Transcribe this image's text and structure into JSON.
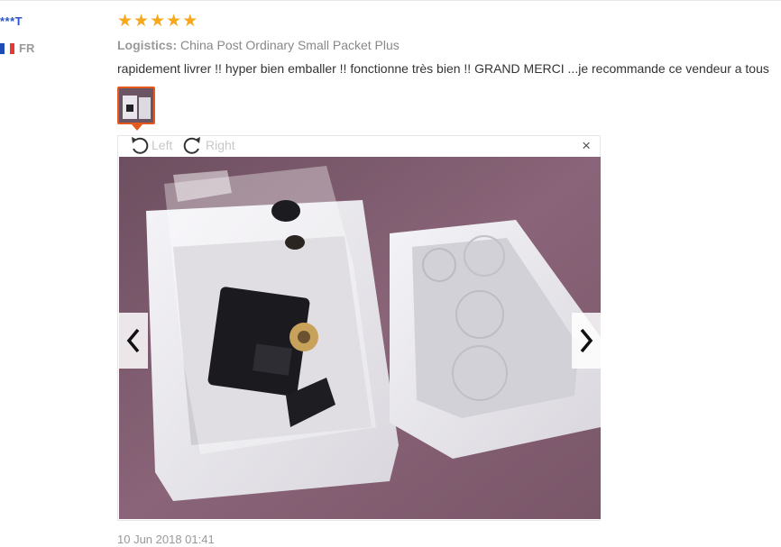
{
  "buyer": {
    "name": "***T",
    "country": "FR",
    "flag_colors": [
      "#1f4bb5",
      "#ffffff",
      "#e53935"
    ]
  },
  "review": {
    "stars": 5,
    "star_color": "#f7a81b",
    "logistics_label": "Logistics:",
    "logistics_value": "China Post Ordinary Small Packet Plus",
    "text": "rapidement livrer !! hyper bien emballer !! fonctionne très bien !! GRAND MERCI ...je recommande ce vendeur a tous",
    "date": "10 Jun 2018 01:41"
  },
  "viewer": {
    "rotate_left_label": "Left",
    "rotate_right_label": "Right",
    "close_label": "×",
    "accent_color": "#e55a1c"
  }
}
